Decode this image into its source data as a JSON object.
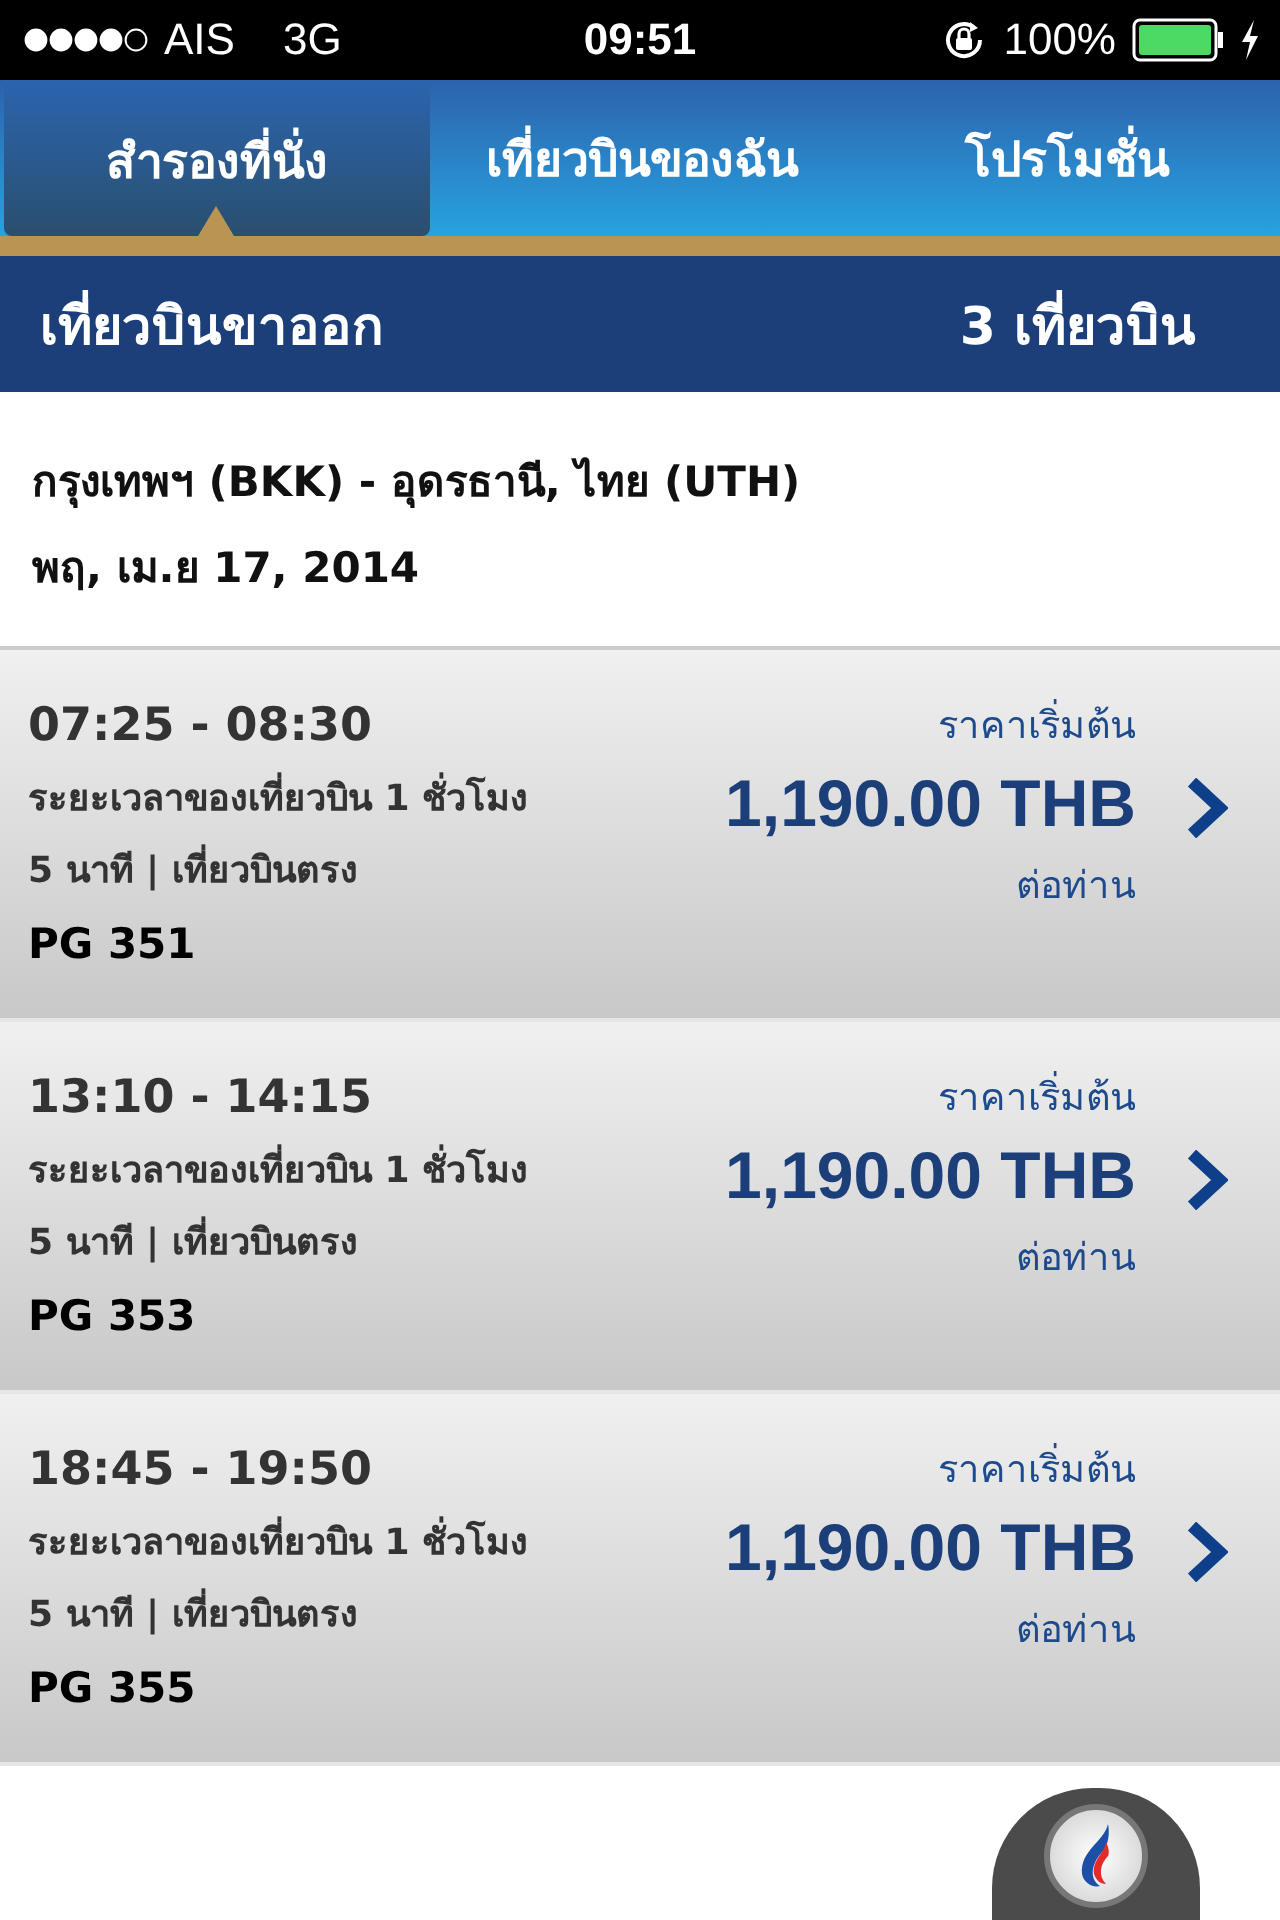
{
  "status_bar": {
    "carrier": "AIS",
    "network": "3G",
    "time": "09:51",
    "battery": "100%"
  },
  "tabs": [
    {
      "label": "สำรองที่นั่ง",
      "selected": true
    },
    {
      "label": "เที่ยวบินของฉัน",
      "selected": false
    },
    {
      "label": "โปรโมชั่น",
      "selected": false
    }
  ],
  "header": {
    "title": "เที่ยวบินขาออก",
    "count": "3 เที่ยวบิน"
  },
  "route": {
    "cities": "กรุงเทพฯ (BKK) - อุดรธานี, ไทย (UTH)",
    "date": "พฤ, เม.ย 17, 2014"
  },
  "flights": [
    {
      "times": "07:25 - 08:30",
      "details": "ระยะเวลาของเที่ยวบิน 1 ชั่วโมง 5 นาที | เที่ยวบินตรง",
      "flight_number": "PG 351",
      "price_label": "ราคาเริ่มต้น",
      "price": "1,190.00 THB",
      "per": "ต่อท่าน"
    },
    {
      "times": "13:10 - 14:15",
      "details": "ระยะเวลาของเที่ยวบิน 1 ชั่วโมง 5 นาที | เที่ยวบินตรง",
      "flight_number": "PG 353",
      "price_label": "ราคาเริ่มต้น",
      "price": "1,190.00 THB",
      "per": "ต่อท่าน"
    },
    {
      "times": "18:45 - 19:50",
      "details": "ระยะเวลาของเที่ยวบิน 1 ชั่วโมง 5 นาที | เที่ยวบินตรง",
      "flight_number": "PG 355",
      "price_label": "ราคาเริ่มต้น",
      "price": "1,190.00 THB",
      "per": "ต่อท่าน"
    }
  ]
}
